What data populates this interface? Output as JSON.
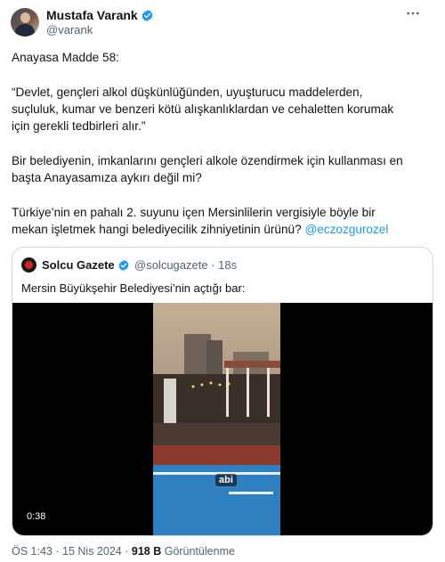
{
  "author": {
    "name": "Mustafa Varank",
    "handle": "@varank",
    "verified": true
  },
  "more_icon": "more-horizontal-icon",
  "tweet": {
    "line1": "Anayasa Madde 58:",
    "quote_l1": "“Devlet, gençleri alkol düşkünlüğünden, uyuşturucu maddelerden,",
    "quote_l2": "suçluluk, kumar ve benzeri kötü alışkanlıklardan ve cehaletten korumak",
    "quote_l3": "için gerekli tedbirleri alır.”",
    "para2_l1": "Bir belediyenin, imkanlarını gençleri alkole özendirmek için kullanması en",
    "para2_l2": "başta Anayasamıza aykırı değil mi?",
    "para3_l1": "Türkiye’nin en pahalı 2. suyunu içen Mersinlilerin vergisiyle böyle bir",
    "para3_l2": "mekan işletmek hangi belediyecilik zihniyetinin ürünü?",
    "mention": "@eczozgurozel"
  },
  "quoted_tweet": {
    "name": "Solcu Gazete",
    "handle": "@solcugazete",
    "time": "18s",
    "separator": "·",
    "text": "Mersin Büyükşehir Belediyesi’nin açtığı bar:",
    "video": {
      "duration": "0:38",
      "caption": "abi"
    }
  },
  "meta": {
    "time": "ÖS 1:43",
    "sep1": "·",
    "date": "15 Nis 2024",
    "sep2": "·",
    "views": "918 B",
    "views_label": "Görüntülenme"
  },
  "colors": {
    "verified": "#1d9bf0",
    "link": "#1d9bf0",
    "muted": "#536471",
    "text": "#0f1419",
    "border": "#cfd9de"
  }
}
